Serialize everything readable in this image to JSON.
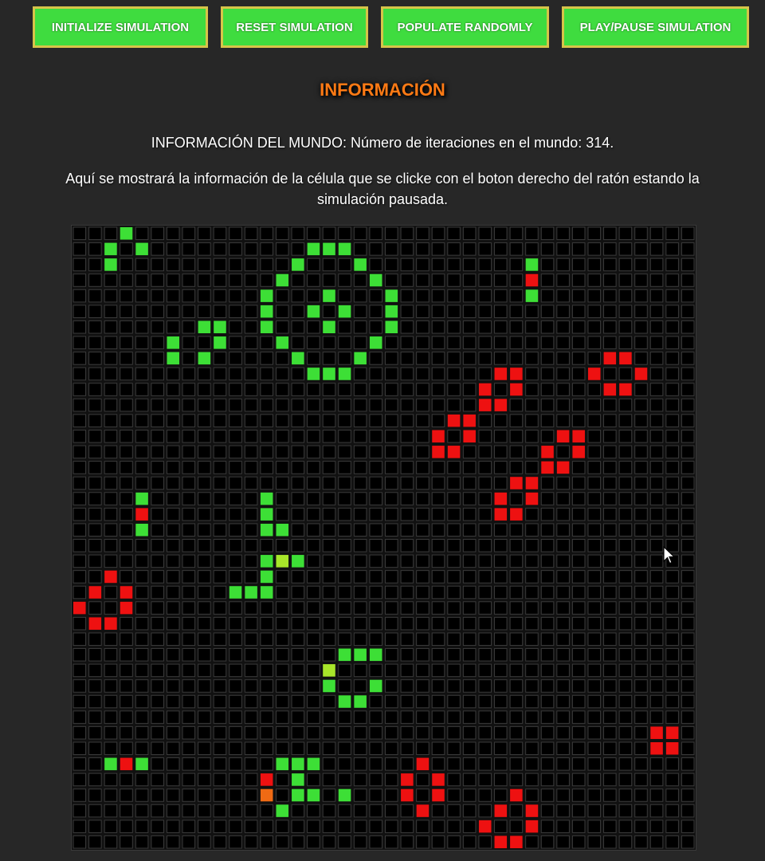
{
  "buttons": {
    "initialize": "INITIALIZE SIMULATION",
    "reset": "RESET SIMULATION",
    "populate": "POPULATE RANDOMLY",
    "play_pause": "PLAY/PAUSE SIMULATION"
  },
  "info_title": "INFORMACIÓN",
  "world_info": "INFORMACIÓN DEL MUNDO: Número de iteraciones en el mundo: 314.",
  "cell_info": "Aquí se mostrará la información de la célula que se clicke con el boton derecho del ratón estando la simulación pausada.",
  "colors": {
    "background": "#272727",
    "button_bg": "#3fdc3f",
    "button_border": "#d7c449",
    "title": "#ff7a14",
    "cell_empty": "#000000",
    "cell_grid_line": "#3a3a3a",
    "cell_green": "#3ddf36",
    "cell_red": "#ee1111",
    "cell_yellow_green": "#a8e62a",
    "cell_orange": "#ef6a14"
  },
  "grid": {
    "rows": 40,
    "cols": 40,
    "cells": {
      "green": [
        [
          0,
          3
        ],
        [
          1,
          2
        ],
        [
          1,
          4
        ],
        [
          2,
          2
        ],
        [
          1,
          15
        ],
        [
          1,
          16
        ],
        [
          1,
          17
        ],
        [
          2,
          14
        ],
        [
          2,
          18
        ],
        [
          3,
          13
        ],
        [
          3,
          19
        ],
        [
          4,
          12
        ],
        [
          4,
          16
        ],
        [
          4,
          20
        ],
        [
          5,
          12
        ],
        [
          5,
          15
        ],
        [
          5,
          17
        ],
        [
          5,
          20
        ],
        [
          6,
          12
        ],
        [
          6,
          16
        ],
        [
          6,
          20
        ],
        [
          7,
          13
        ],
        [
          7,
          19
        ],
        [
          8,
          14
        ],
        [
          8,
          18
        ],
        [
          9,
          15
        ],
        [
          9,
          16
        ],
        [
          9,
          17
        ],
        [
          6,
          8
        ],
        [
          6,
          9
        ],
        [
          7,
          6
        ],
        [
          7,
          9
        ],
        [
          8,
          6
        ],
        [
          8,
          8
        ],
        [
          2,
          29
        ],
        [
          4,
          29
        ],
        [
          17,
          4
        ],
        [
          19,
          4
        ],
        [
          17,
          12
        ],
        [
          18,
          12
        ],
        [
          19,
          12
        ],
        [
          19,
          13
        ],
        [
          21,
          12
        ],
        [
          21,
          14
        ],
        [
          22,
          12
        ],
        [
          23,
          10
        ],
        [
          23,
          11
        ],
        [
          23,
          12
        ],
        [
          27,
          17
        ],
        [
          27,
          18
        ],
        [
          27,
          19
        ],
        [
          29,
          16
        ],
        [
          29,
          19
        ],
        [
          30,
          17
        ],
        [
          30,
          18
        ],
        [
          34,
          2
        ],
        [
          34,
          4
        ],
        [
          34,
          13
        ],
        [
          34,
          14
        ],
        [
          34,
          15
        ],
        [
          35,
          14
        ],
        [
          36,
          14
        ],
        [
          36,
          15
        ],
        [
          36,
          17
        ],
        [
          37,
          13
        ]
      ],
      "red": [
        [
          3,
          29
        ],
        [
          9,
          27
        ],
        [
          9,
          28
        ],
        [
          10,
          26
        ],
        [
          10,
          28
        ],
        [
          11,
          26
        ],
        [
          11,
          27
        ],
        [
          8,
          34
        ],
        [
          8,
          35
        ],
        [
          9,
          33
        ],
        [
          9,
          36
        ],
        [
          10,
          34
        ],
        [
          10,
          35
        ],
        [
          12,
          24
        ],
        [
          12,
          25
        ],
        [
          13,
          23
        ],
        [
          13,
          25
        ],
        [
          14,
          23
        ],
        [
          14,
          24
        ],
        [
          13,
          31
        ],
        [
          13,
          32
        ],
        [
          14,
          30
        ],
        [
          14,
          32
        ],
        [
          15,
          30
        ],
        [
          15,
          31
        ],
        [
          16,
          28
        ],
        [
          16,
          29
        ],
        [
          17,
          27
        ],
        [
          17,
          29
        ],
        [
          18,
          27
        ],
        [
          18,
          28
        ],
        [
          18,
          4
        ],
        [
          22,
          2
        ],
        [
          23,
          1
        ],
        [
          23,
          3
        ],
        [
          24,
          0
        ],
        [
          24,
          3
        ],
        [
          25,
          1
        ],
        [
          25,
          2
        ],
        [
          32,
          37
        ],
        [
          32,
          38
        ],
        [
          33,
          37
        ],
        [
          33,
          38
        ],
        [
          34,
          3
        ],
        [
          35,
          12
        ],
        [
          34,
          22
        ],
        [
          35,
          21
        ],
        [
          35,
          23
        ],
        [
          36,
          21
        ],
        [
          36,
          23
        ],
        [
          37,
          22
        ],
        [
          36,
          28
        ],
        [
          37,
          27
        ],
        [
          37,
          29
        ],
        [
          38,
          26
        ],
        [
          38,
          29
        ],
        [
          39,
          27
        ],
        [
          39,
          28
        ]
      ],
      "yellow_green": [
        [
          21,
          13
        ],
        [
          28,
          16
        ]
      ],
      "orange": [
        [
          36,
          12
        ]
      ]
    }
  }
}
